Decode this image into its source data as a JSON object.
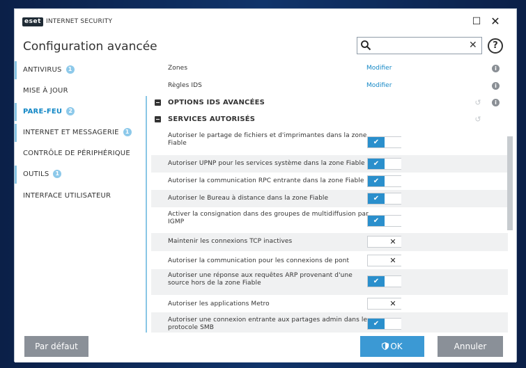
{
  "window": {
    "logo_text": "eset",
    "product_name": "INTERNET SECURITY",
    "maximize_glyph": "☐",
    "close_glyph": "✕"
  },
  "header": {
    "title": "Configuration avancée",
    "search_placeholder": "",
    "search_clear_glyph": "✕",
    "help_glyph": "?"
  },
  "sidebar": {
    "items": [
      {
        "label": "ANTIVIRUS",
        "badge": "1"
      },
      {
        "label": "MISE À JOUR",
        "badge": ""
      },
      {
        "label": "PARE-FEU",
        "badge": "2"
      },
      {
        "label": "INTERNET ET MESSAGERIE",
        "badge": "1"
      },
      {
        "label": "CONTRÔLE DE PÉRIPHÉRIQUE",
        "badge": ""
      },
      {
        "label": "OUTILS",
        "badge": "1"
      },
      {
        "label": "INTERFACE UTILISATEUR",
        "badge": ""
      }
    ]
  },
  "content": {
    "link_rows": [
      {
        "label": "Zones",
        "link": "Modifier"
      },
      {
        "label": "Règles IDS",
        "link": "Modifier"
      }
    ],
    "info_glyph": "i",
    "reset_glyph": "↺",
    "sections": [
      {
        "title": "OPTIONS IDS AVANCÉES"
      },
      {
        "title": "SERVICES AUTORISÉS"
      }
    ],
    "toggle_on_glyph": "✔",
    "toggle_off_glyph": "✕",
    "settings": [
      {
        "label_line1": "Autoriser le partage de fichiers et d'imprimantes dans la zone",
        "label_line2": "Fiable",
        "enabled": true
      },
      {
        "label_line1": "Autoriser UPNP pour les services système dans la zone Fiable",
        "label_line2": "",
        "enabled": true
      },
      {
        "label_line1": "Autoriser la communication RPC entrante dans la zone Fiable",
        "label_line2": "",
        "enabled": true
      },
      {
        "label_line1": "Autoriser le Bureau à distance dans la zone Fiable",
        "label_line2": "",
        "enabled": true
      },
      {
        "label_line1": "Activer la consignation dans des groupes de multidiffusion par",
        "label_line2": "IGMP",
        "enabled": true
      },
      {
        "label_line1": "Maintenir les connexions TCP inactives",
        "label_line2": "",
        "enabled": false
      },
      {
        "label_line1": "Autoriser la communication pour les connexions de pont",
        "label_line2": "",
        "enabled": false
      },
      {
        "label_line1": "Autoriser une réponse aux requêtes ARP provenant d'une",
        "label_line2": "source hors de la zone Fiable",
        "enabled": true
      },
      {
        "label_line1": "Autoriser les applications Metro",
        "label_line2": "",
        "enabled": false
      },
      {
        "label_line1": "Autoriser une connexion entrante aux partages admin dans le",
        "label_line2": "protocole SMB",
        "enabled": true
      }
    ]
  },
  "footer": {
    "default_label": "Par défaut",
    "ok_label": "OK",
    "cancel_label": "Annuler"
  },
  "colors": {
    "accent": "#1488c6",
    "toggle_on": "#2a8fcc",
    "ok_button": "#3b99d4",
    "secondary_button": "#8a9098",
    "sidebar_marker": "#89c6e5"
  }
}
